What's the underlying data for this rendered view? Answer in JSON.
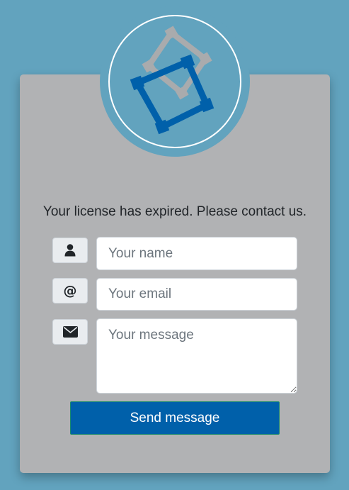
{
  "contact": {
    "message": "Your license has expired. Please contact us.",
    "name_placeholder": "Your name",
    "email_placeholder": "Your email",
    "message_placeholder": "Your message",
    "send_label": "Send message"
  },
  "icons": {
    "name": "user-icon",
    "email": "at-icon",
    "message": "envelope-icon",
    "logo": "squares-logo-icon"
  },
  "colors": {
    "background": "#62a3be",
    "card": "#b1b2b4",
    "button": "#0060aa",
    "logo_primary": "#0060aa",
    "logo_secondary": "#a9abad"
  }
}
